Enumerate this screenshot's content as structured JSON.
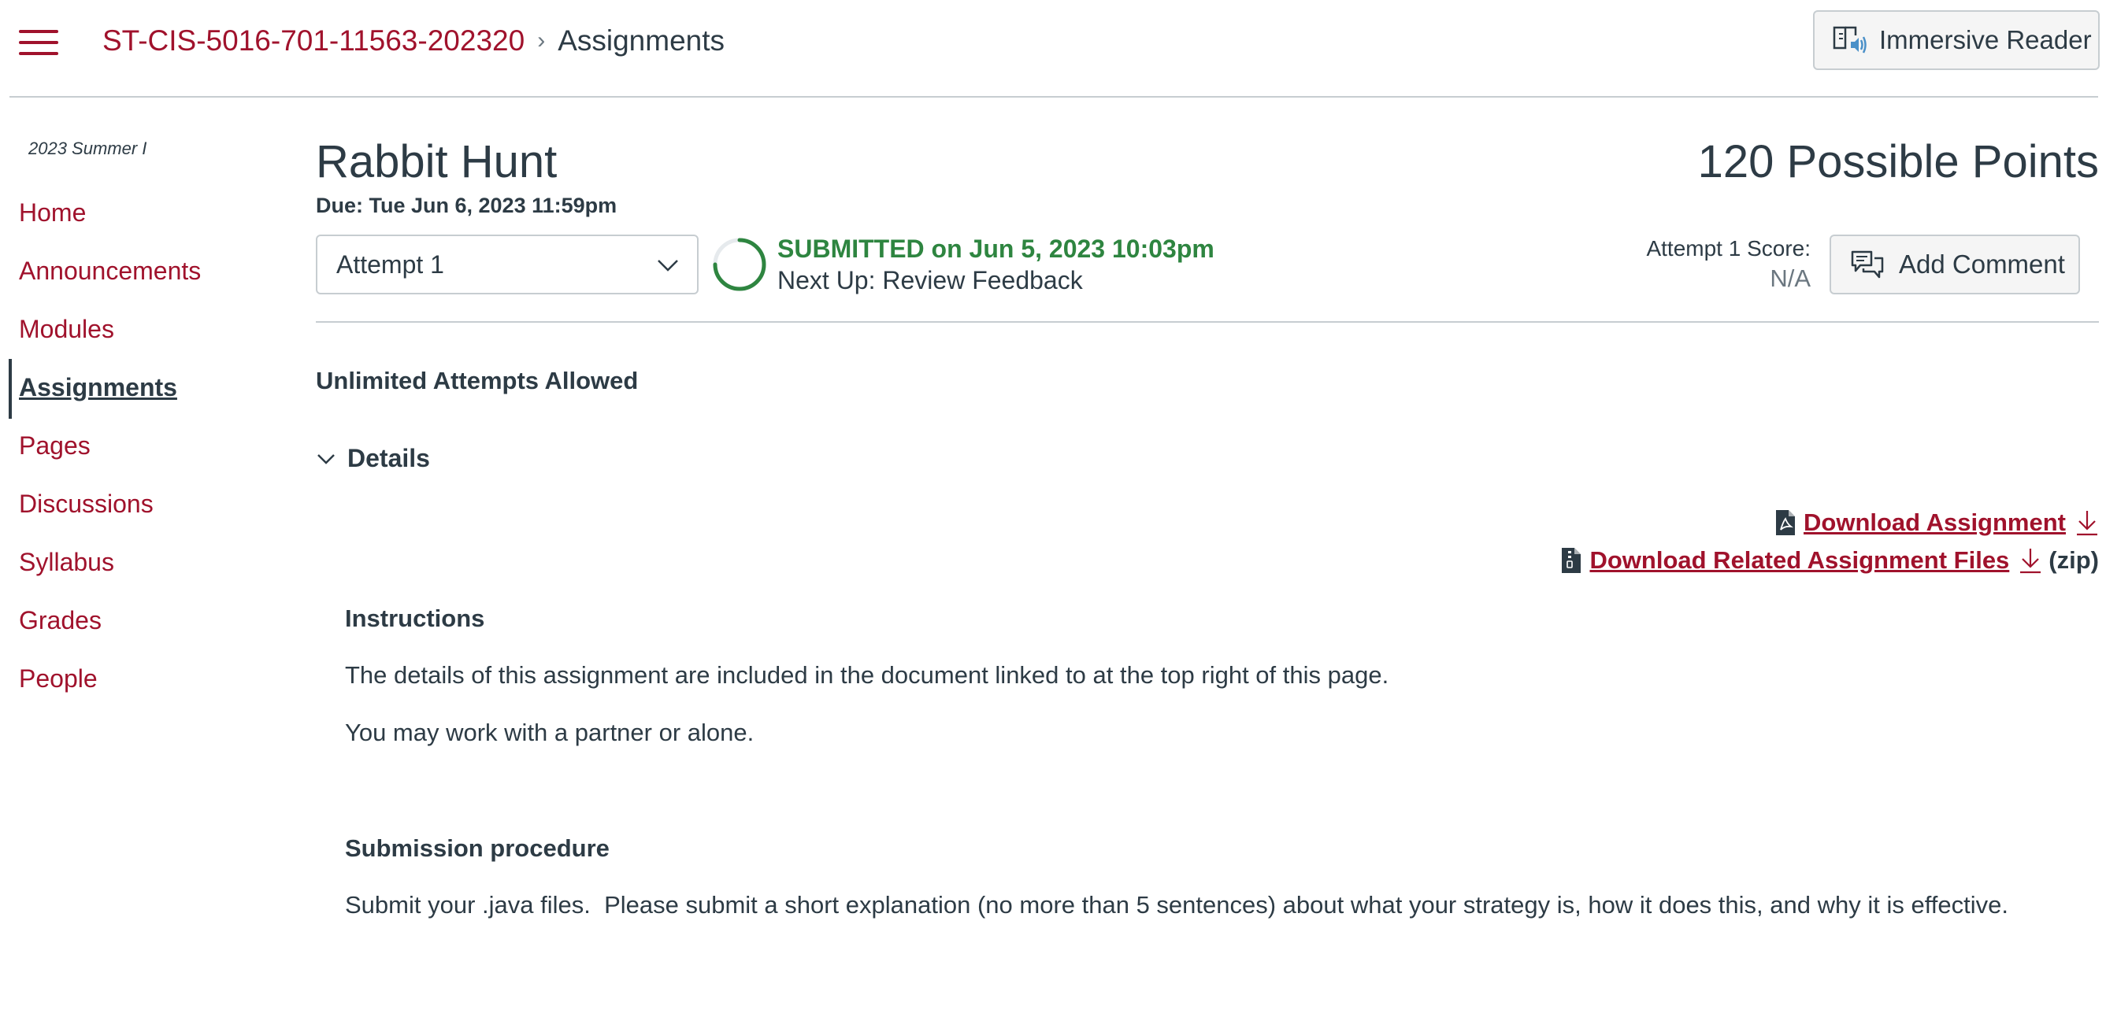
{
  "header": {
    "course_code": "ST-CIS-5016-701-11563-202320",
    "separator": "›",
    "current_page": "Assignments",
    "immersive_reader_label": "Immersive Reader"
  },
  "sidebar": {
    "term": "2023 Summer I",
    "items": [
      {
        "label": "Home"
      },
      {
        "label": "Announcements"
      },
      {
        "label": "Modules"
      },
      {
        "label": "Assignments",
        "active": true
      },
      {
        "label": "Pages"
      },
      {
        "label": "Discussions"
      },
      {
        "label": "Syllabus"
      },
      {
        "label": "Grades"
      },
      {
        "label": "People"
      }
    ]
  },
  "assignment": {
    "title": "Rabbit Hunt",
    "due": "Due: Tue Jun 6, 2023 11:59pm",
    "points": "120 Possible Points",
    "attempt_selected": "Attempt 1",
    "status_submitted": "SUBMITTED on Jun 5, 2023 10:03pm",
    "status_next": "Next Up: Review Feedback",
    "score_label": "Attempt 1 Score:",
    "score_value": "N/A",
    "add_comment_label": "Add Comment",
    "attempts_allowed": "Unlimited Attempts Allowed",
    "details_label": "Details",
    "download_assignment": "Download Assignment",
    "download_related": "Download Related Assignment Files",
    "download_related_suffix": "(zip)"
  },
  "instructions": {
    "heading": "Instructions",
    "para1": "The details of this assignment are included in the document linked to at the top right of this page.",
    "para2": "You may work with a partner or alone.",
    "submission_heading": "Submission procedure",
    "submission_text": "Submit your .java files.  Please submit a short explanation (no more than 5 sentences) about what your strategy is, how it does this, and why it is effective."
  },
  "colors": {
    "brand": "#a0122c",
    "text": "#2d3b45",
    "success": "#2e8540",
    "muted": "#6b7780",
    "border": "#c7cdd1"
  },
  "icons": {
    "menu": "hamburger-menu-icon",
    "immersive_reader": "immersive-reader-icon",
    "attempt_dropdown": "chevron-down-icon",
    "submission_progress": "progress-ring-icon",
    "add_comment": "comment-icon",
    "details_toggle": "chevron-down-icon",
    "pdf_file": "pdf-file-icon",
    "zip_file": "zip-file-icon",
    "download": "download-icon"
  }
}
